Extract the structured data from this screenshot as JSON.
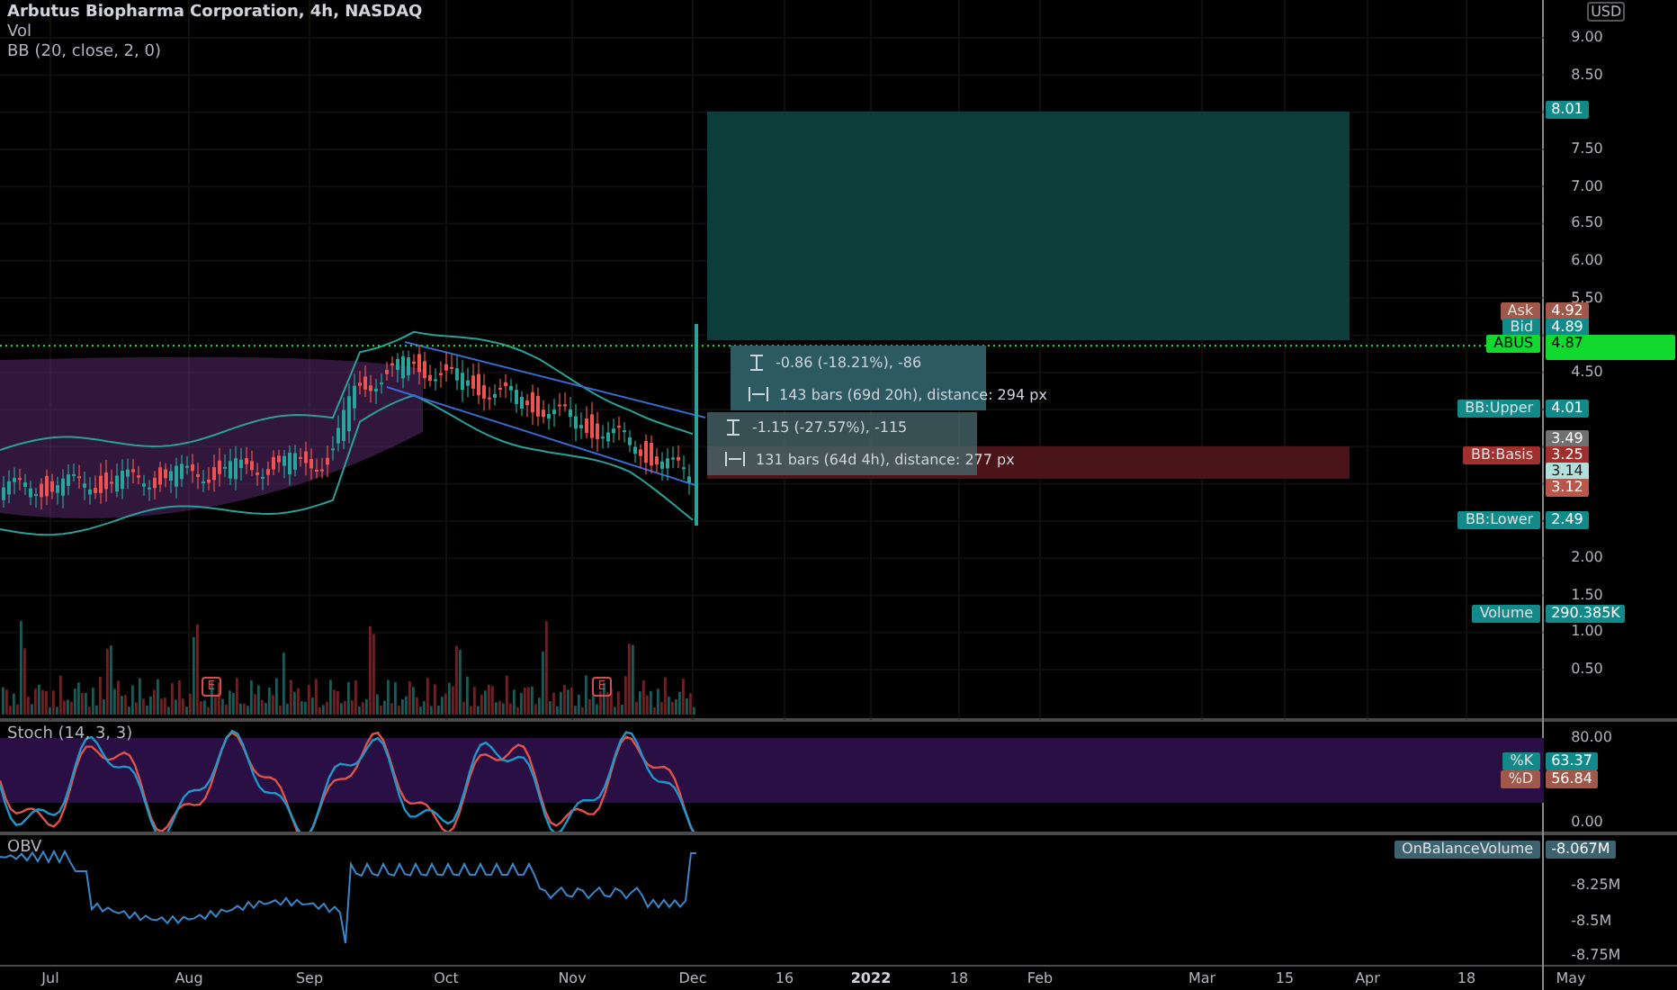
{
  "legend": {
    "title": "Arbutus Biopharma Corporation, 4h, NASDAQ",
    "lines": [
      "Vol",
      "BB (20, close, 2, 0)"
    ]
  },
  "currency": "USD",
  "price_axis": [
    "9.00",
    "8.50",
    "7.50",
    "7.00",
    "6.50",
    "6.00",
    "5.50",
    "4.50",
    "2.00",
    "1.50",
    "1.00",
    "0.50"
  ],
  "price_tags": [
    {
      "kind": "value",
      "value": "8.01",
      "color": "#138a8a"
    },
    {
      "kind": "labelled",
      "label": "Ask",
      "value": "4.92",
      "color": "#a0584a"
    },
    {
      "kind": "labelled",
      "label": "Bid",
      "value": "4.89",
      "color": "#138a8a"
    },
    {
      "kind": "symbol",
      "label": "ABUS",
      "value": "4.87",
      "color": "#11d92e"
    },
    {
      "kind": "labelled",
      "label": "BB:Upper",
      "value": "4.01",
      "color": "#138a8a"
    },
    {
      "kind": "value",
      "value": "3.49",
      "color": "#707070"
    },
    {
      "kind": "labelled",
      "label": "BB:Basis",
      "value": "3.25",
      "color": "#a0302e"
    },
    {
      "kind": "value",
      "value": "3.14",
      "color": "#b2dfdb"
    },
    {
      "kind": "value",
      "value": "3.12",
      "color": "#b8574a"
    },
    {
      "kind": "labelled",
      "label": "BB:Lower",
      "value": "2.49",
      "color": "#138a8a"
    },
    {
      "kind": "labelled",
      "label": "Volume",
      "value": "290.385K",
      "color": "#138a8a"
    }
  ],
  "measurements": [
    {
      "price": "-0.86 (-18.21%), -86",
      "bars": "143 bars (69d 20h), distance: 294 px"
    },
    {
      "price": "-1.15 (-27.57%), -115",
      "bars": "131 bars (64d 4h), distance: 277 px"
    }
  ],
  "earnings_markers": [
    "E",
    "E"
  ],
  "stoch": {
    "title": "Stoch (14, 3, 3)",
    "axis": [
      "80.00",
      "0.00"
    ],
    "tags": [
      {
        "label": "%K",
        "value": "63.37",
        "color": "#138a8a"
      },
      {
        "label": "%D",
        "value": "56.84",
        "color": "#a0584a"
      }
    ]
  },
  "obv": {
    "title": "OBV",
    "axis": [
      "-8.25M",
      "-8.5M",
      "-8.75M"
    ],
    "tag": {
      "label": "OnBalanceVolume",
      "value": "-8.067M",
      "color": "#3d6370"
    }
  },
  "time_axis": [
    "Jul",
    "Aug",
    "Sep",
    "Oct",
    "Nov",
    "Dec",
    "16",
    "2022",
    "18",
    "Feb",
    "Mar",
    "15",
    "Apr",
    "18",
    "May"
  ]
}
